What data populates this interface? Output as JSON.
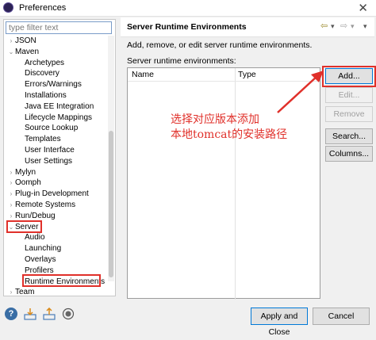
{
  "window": {
    "title": "Preferences",
    "close_glyph": "✕"
  },
  "filter": {
    "placeholder": "type filter text"
  },
  "tree": [
    {
      "label": "JSON",
      "arrow": "›"
    },
    {
      "label": "Maven",
      "arrow": "⌄"
    },
    {
      "label": "Archetypes"
    },
    {
      "label": "Discovery"
    },
    {
      "label": "Errors/Warnings"
    },
    {
      "label": "Installations"
    },
    {
      "label": "Java EE Integration"
    },
    {
      "label": "Lifecycle Mappings"
    },
    {
      "label": "Source Lookup"
    },
    {
      "label": "Templates"
    },
    {
      "label": "User Interface"
    },
    {
      "label": "User Settings"
    },
    {
      "label": "Mylyn",
      "arrow": "›"
    },
    {
      "label": "Oomph",
      "arrow": "›"
    },
    {
      "label": "Plug-in Development",
      "arrow": "›"
    },
    {
      "label": "Remote Systems",
      "arrow": "›"
    },
    {
      "label": "Run/Debug",
      "arrow": "›"
    },
    {
      "label": "Server",
      "arrow": "⌄"
    },
    {
      "label": "Audio"
    },
    {
      "label": "Launching"
    },
    {
      "label": "Overlays"
    },
    {
      "label": "Profilers"
    },
    {
      "label": "Runtime Environments"
    },
    {
      "label": "Team",
      "arrow": "›"
    }
  ],
  "page": {
    "title": "Server Runtime Environments",
    "nav_back": "⇦",
    "nav_back_menu": "▾",
    "nav_fwd": "⇨",
    "nav_fwd_menu": "▾",
    "nav_menu": "▾",
    "description": "Add, remove, or edit server runtime environments.",
    "list_label": "Server runtime environments:",
    "columns": [
      "Name",
      "Type"
    ]
  },
  "buttons": {
    "add": "Add...",
    "edit": "Edit...",
    "remove": "Remove",
    "search": "Search...",
    "columns": "Columns..."
  },
  "annotation": {
    "line1": "选择对应版本添加",
    "line2": "本地tomcat的安装路径"
  },
  "bottom": {
    "help": "?",
    "apply_close": "Apply and Close",
    "cancel": "Cancel"
  },
  "colors": {
    "highlight": "#e0302a",
    "focus": "#0078d7"
  }
}
